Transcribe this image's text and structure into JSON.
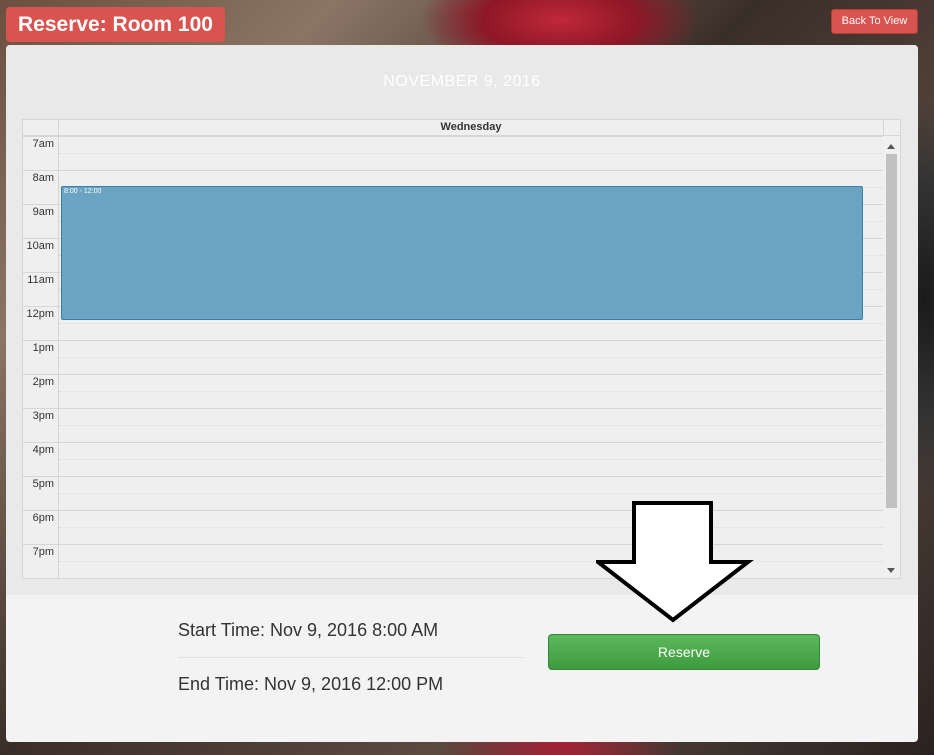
{
  "header": {
    "title": "Reserve: Room 100",
    "back_label": "Back To View"
  },
  "calendar": {
    "date": "NOVEMBER 9, 2016",
    "day": "Wednesday",
    "hours": [
      "7am",
      "8am",
      "9am",
      "10am",
      "11am",
      "12pm",
      "1pm",
      "2pm",
      "3pm",
      "4pm",
      "5pm",
      "6pm",
      "7pm"
    ],
    "event": {
      "label": "8:00 - 12:00",
      "color": "#6aa4c2"
    }
  },
  "details": {
    "start": "Start Time: Nov 9, 2016 8:00 AM",
    "end": "End Time: Nov 9, 2016 12:00 PM"
  },
  "actions": {
    "reserve_label": "Reserve"
  },
  "colors": {
    "danger": "#d9534f",
    "success": "#5cb85c"
  }
}
